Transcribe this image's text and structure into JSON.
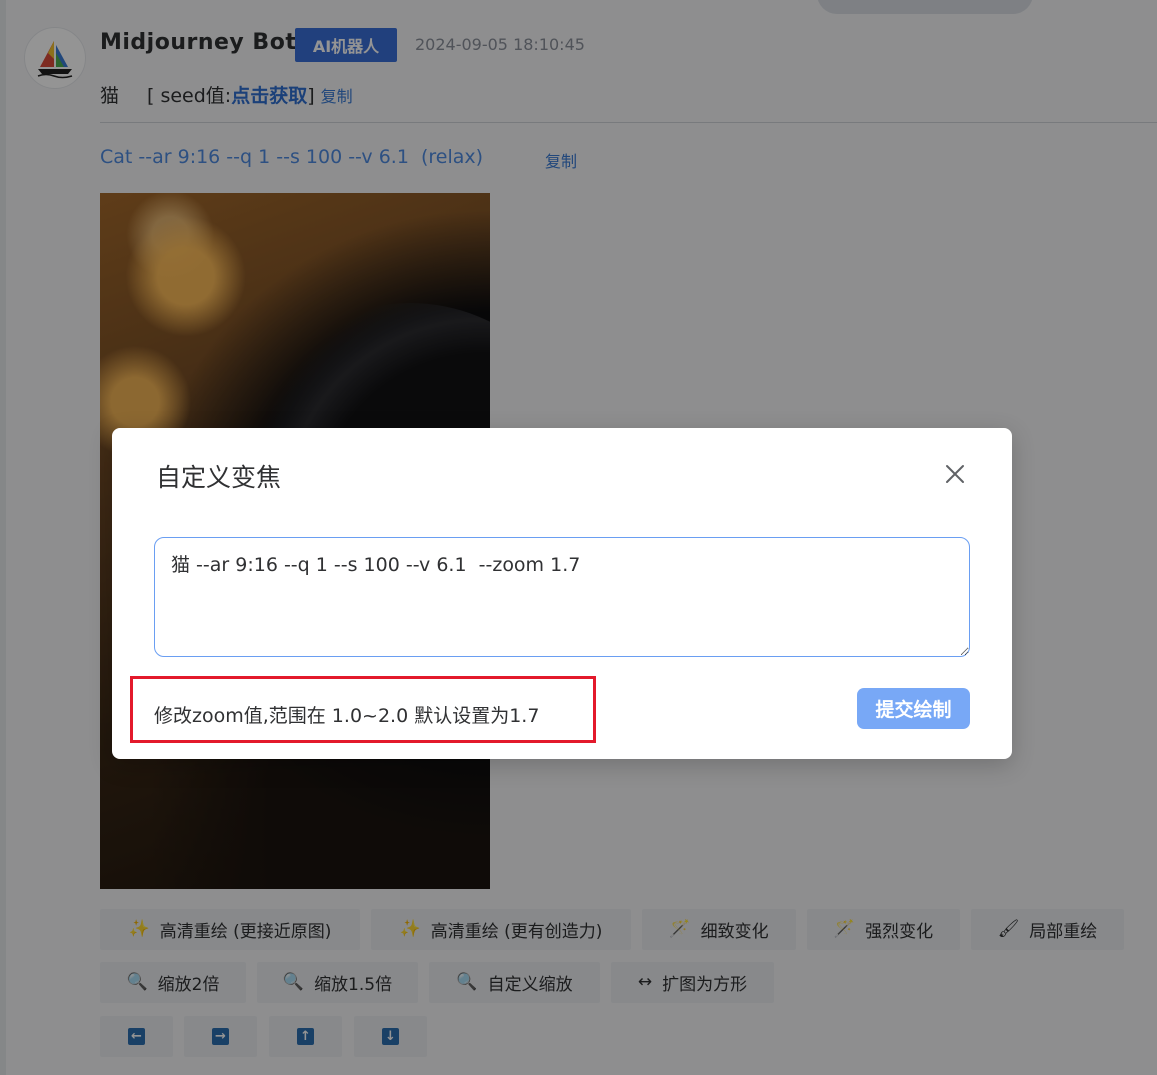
{
  "message": {
    "bot_name": "Midjourney Bot",
    "badge": "AI机器人",
    "timestamp": "2024-09-05 18:10:45",
    "seed": {
      "prefix": "猫",
      "label_open": "[ seed值: ",
      "link": "点击获取",
      "label_close": " ]",
      "copy": "复制"
    },
    "prompt": "Cat --ar 9:16 --q 1 --s 100 --v 6.1  (relax)",
    "prompt_copy": "复制"
  },
  "actions": {
    "row1": [
      {
        "icon": "sparkle-icon",
        "glyph": "✨",
        "label": "高清重绘 (更接近原图)"
      },
      {
        "icon": "sparkle-icon",
        "glyph": "✨",
        "label": "高清重绘 (更有创造力)"
      },
      {
        "icon": "magic-wand-icon",
        "glyph": "🪄",
        "label": "细致变化"
      },
      {
        "icon": "magic-wand-icon",
        "glyph": "🪄",
        "label": "强烈变化"
      },
      {
        "icon": "brush-icon",
        "glyph": "🖌",
        "label": "局部重绘"
      }
    ],
    "row2": [
      {
        "icon": "magnifier-icon",
        "glyph": "🔍",
        "label": "缩放2倍"
      },
      {
        "icon": "magnifier-icon",
        "glyph": "🔍",
        "label": "缩放1.5倍"
      },
      {
        "icon": "magnifier-icon",
        "glyph": "🔍",
        "label": "自定义缩放"
      },
      {
        "icon": "expand-arrows-icon",
        "glyph": "↔",
        "label": "扩图为方形"
      }
    ],
    "row3": [
      {
        "icon": "arrow-left-icon",
        "glyph": "←"
      },
      {
        "icon": "arrow-right-icon",
        "glyph": "→"
      },
      {
        "icon": "arrow-up-icon",
        "glyph": "↑"
      },
      {
        "icon": "arrow-down-icon",
        "glyph": "↓"
      }
    ]
  },
  "dialog": {
    "title": "自定义变焦",
    "input_value": "猫 --ar 9:16 --q 1 --s 100 --v 6.1  --zoom 1.7",
    "hint": "修改zoom值,范围在 1.0~2.0 默认设置为1.7",
    "submit": "提交绘制"
  },
  "colors": {
    "accent": "#3a6fd8",
    "link": "#4e8be0",
    "highlight_border": "#e3192b",
    "submit": "#78a8f6"
  }
}
